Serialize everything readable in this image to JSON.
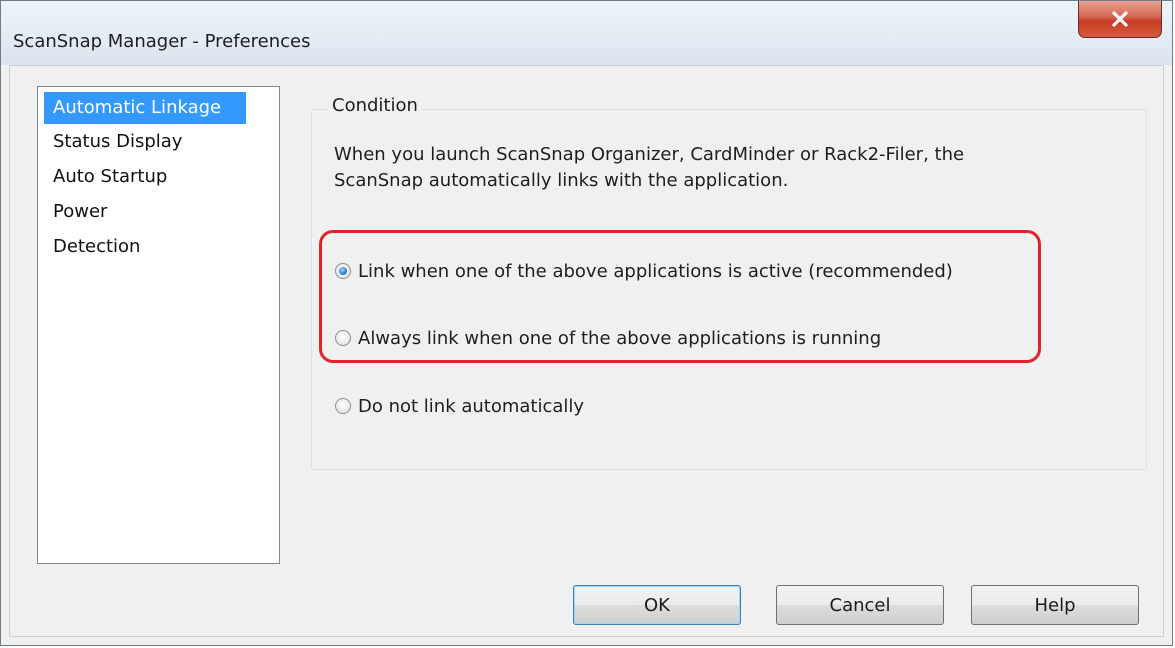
{
  "window": {
    "title": "ScanSnap Manager - Preferences",
    "close_icon": "close-x-icon"
  },
  "sidebar": {
    "items": [
      {
        "label": "Automatic Linkage",
        "selected": true
      },
      {
        "label": "Status Display",
        "selected": false
      },
      {
        "label": "Auto Startup",
        "selected": false
      },
      {
        "label": "Power",
        "selected": false
      },
      {
        "label": "Detection",
        "selected": false
      }
    ]
  },
  "condition": {
    "group_label": "Condition",
    "description_line1": "When you launch ScanSnap Organizer, CardMinder or Rack2-Filer, the",
    "description_line2": "ScanSnap automatically links with the application.",
    "options": [
      {
        "label": "Link when one of the above applications is active (recommended)",
        "checked": true
      },
      {
        "label": "Always link when one of the above applications is running",
        "checked": false
      },
      {
        "label": "Do not link automatically",
        "checked": false
      }
    ]
  },
  "buttons": {
    "ok": "OK",
    "cancel": "Cancel",
    "help": "Help"
  },
  "colors": {
    "selection": "#3399ff",
    "highlight_annotation": "#e2222a"
  }
}
